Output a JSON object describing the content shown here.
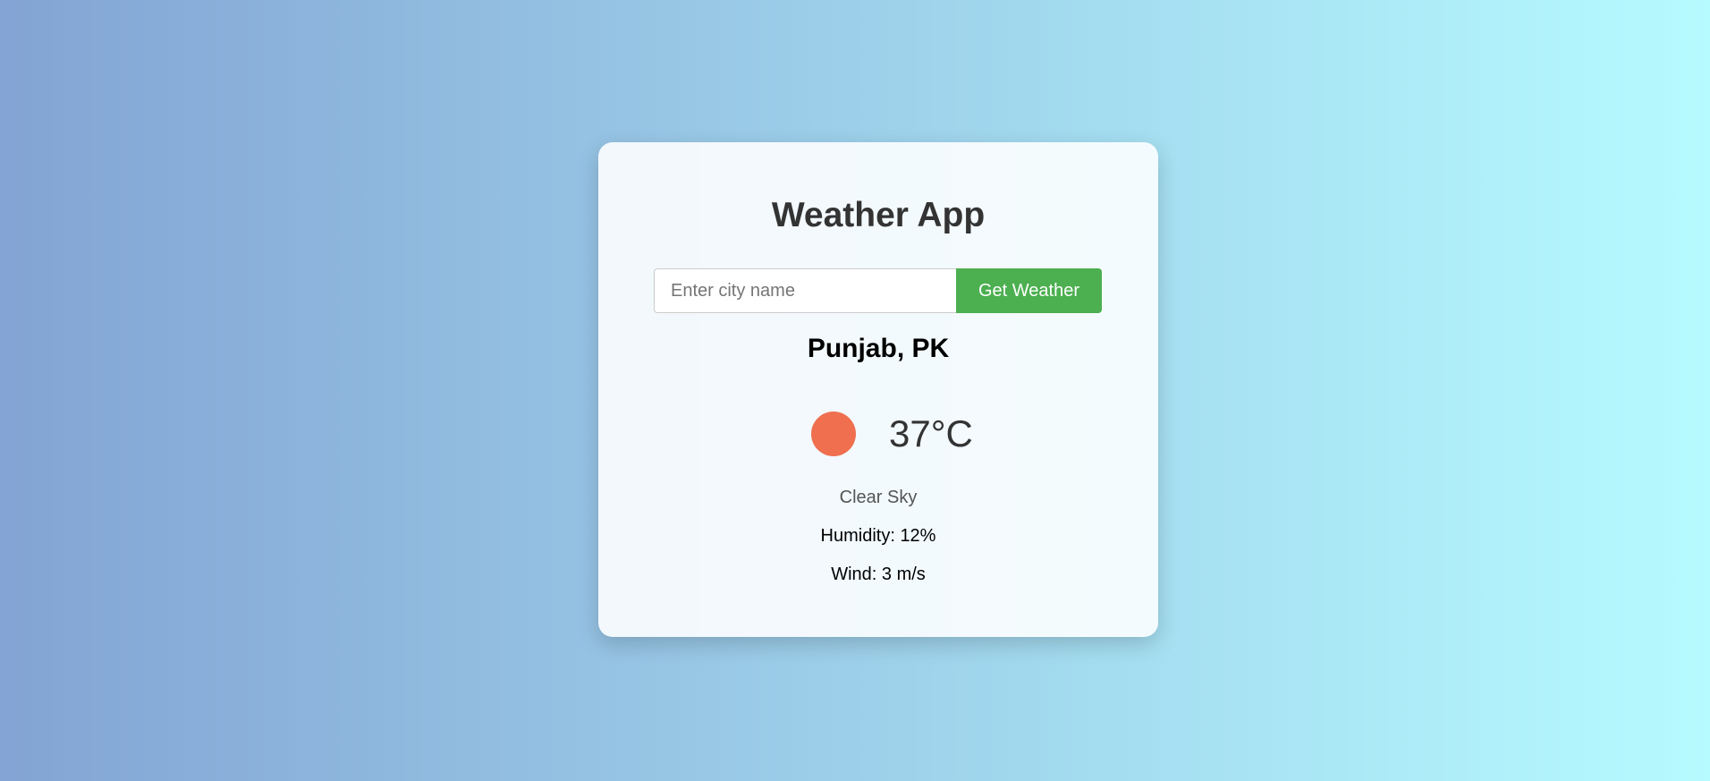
{
  "app": {
    "title": "Weather App"
  },
  "search": {
    "placeholder": "Enter city name",
    "value": "",
    "button_label": "Get Weather"
  },
  "weather": {
    "location": "Punjab, PK",
    "icon": "sun-icon",
    "icon_color": "#ef6f4f",
    "temperature": "37°C",
    "description": "Clear Sky",
    "humidity": "Humidity: 12%",
    "wind": "Wind: 3 m/s"
  },
  "colors": {
    "gradient_start": "#83a4d4",
    "gradient_end": "#b6fbff",
    "button": "#4caf50"
  }
}
